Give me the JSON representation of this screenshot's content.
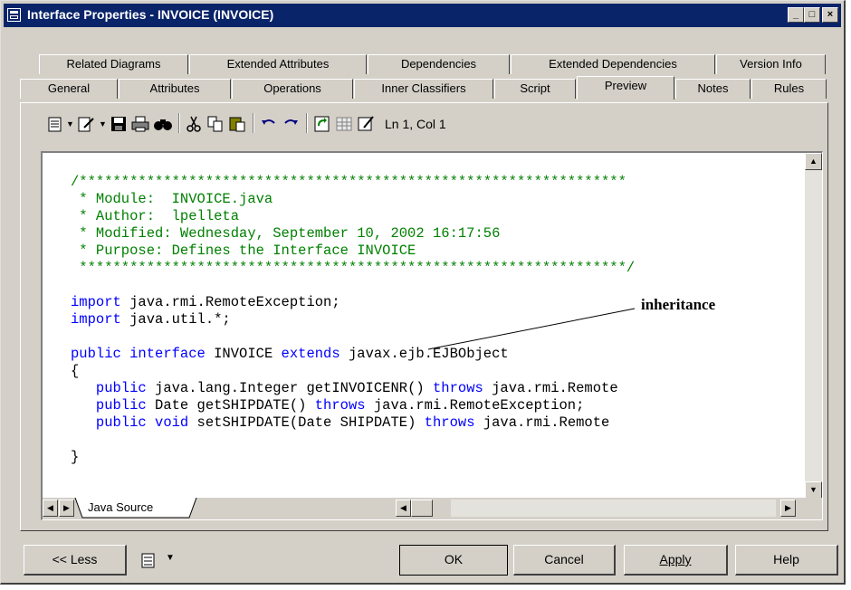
{
  "window": {
    "title": "Interface Properties - INVOICE (INVOICE)",
    "controls": [
      "_",
      "□",
      "×"
    ]
  },
  "tabs_row1": [
    "Related Diagrams",
    "Extended Attributes",
    "Dependencies",
    "Extended Dependencies",
    "Version Info"
  ],
  "tabs_row2": [
    "General",
    "Attributes",
    "Operations",
    "Inner Classifiers",
    "Script",
    "Preview",
    "Notes",
    "Rules"
  ],
  "active_tab": "Preview",
  "toolbar": {
    "position": "Ln 1, Col 1"
  },
  "code": {
    "header": [
      "/*****************************************************************",
      " * Module:  INVOICE.java",
      " * Author:  lpelleta",
      " * Modified: Wednesday, September 10, 2002 16:17:56",
      " * Purpose: Defines the Interface INVOICE",
      " *****************************************************************/"
    ],
    "import1_kw": "import",
    "import1_rest": " java.rmi.RemoteException;",
    "import2_kw": "import",
    "import2_rest": " java.util.*;",
    "decl_kw1": "public interface",
    "decl_name": " INVOICE ",
    "decl_kw2": "extends",
    "decl_rest": " javax.ejb.EJBObject",
    "open_brace": "{",
    "m1_kw": "public",
    "m1_mid": " java.lang.Integer getINVOICENR() ",
    "m1_kw2": "throws",
    "m1_rest": " java.rmi.Remote",
    "m2_kw": "public",
    "m2_mid": " Date getSHIPDATE() ",
    "m2_kw2": "throws",
    "m2_rest": " java.rmi.RemoteException;",
    "m3_kw": "public void",
    "m3_mid": " setSHIPDATE(Date SHIPDATE) ",
    "m3_kw2": "throws",
    "m3_rest": " java.rmi.Remote",
    "close_brace": "}"
  },
  "annotation": "inheritance",
  "source_tab": "Java Source",
  "buttons": {
    "less": "<< Less",
    "ok": "OK",
    "cancel": "Cancel",
    "apply": "Apply",
    "help": "Help"
  },
  "colors": {
    "comment": "#008000",
    "keyword": "#0000ff",
    "titlebar": "#0a246a",
    "face": "#d4d0c8"
  }
}
